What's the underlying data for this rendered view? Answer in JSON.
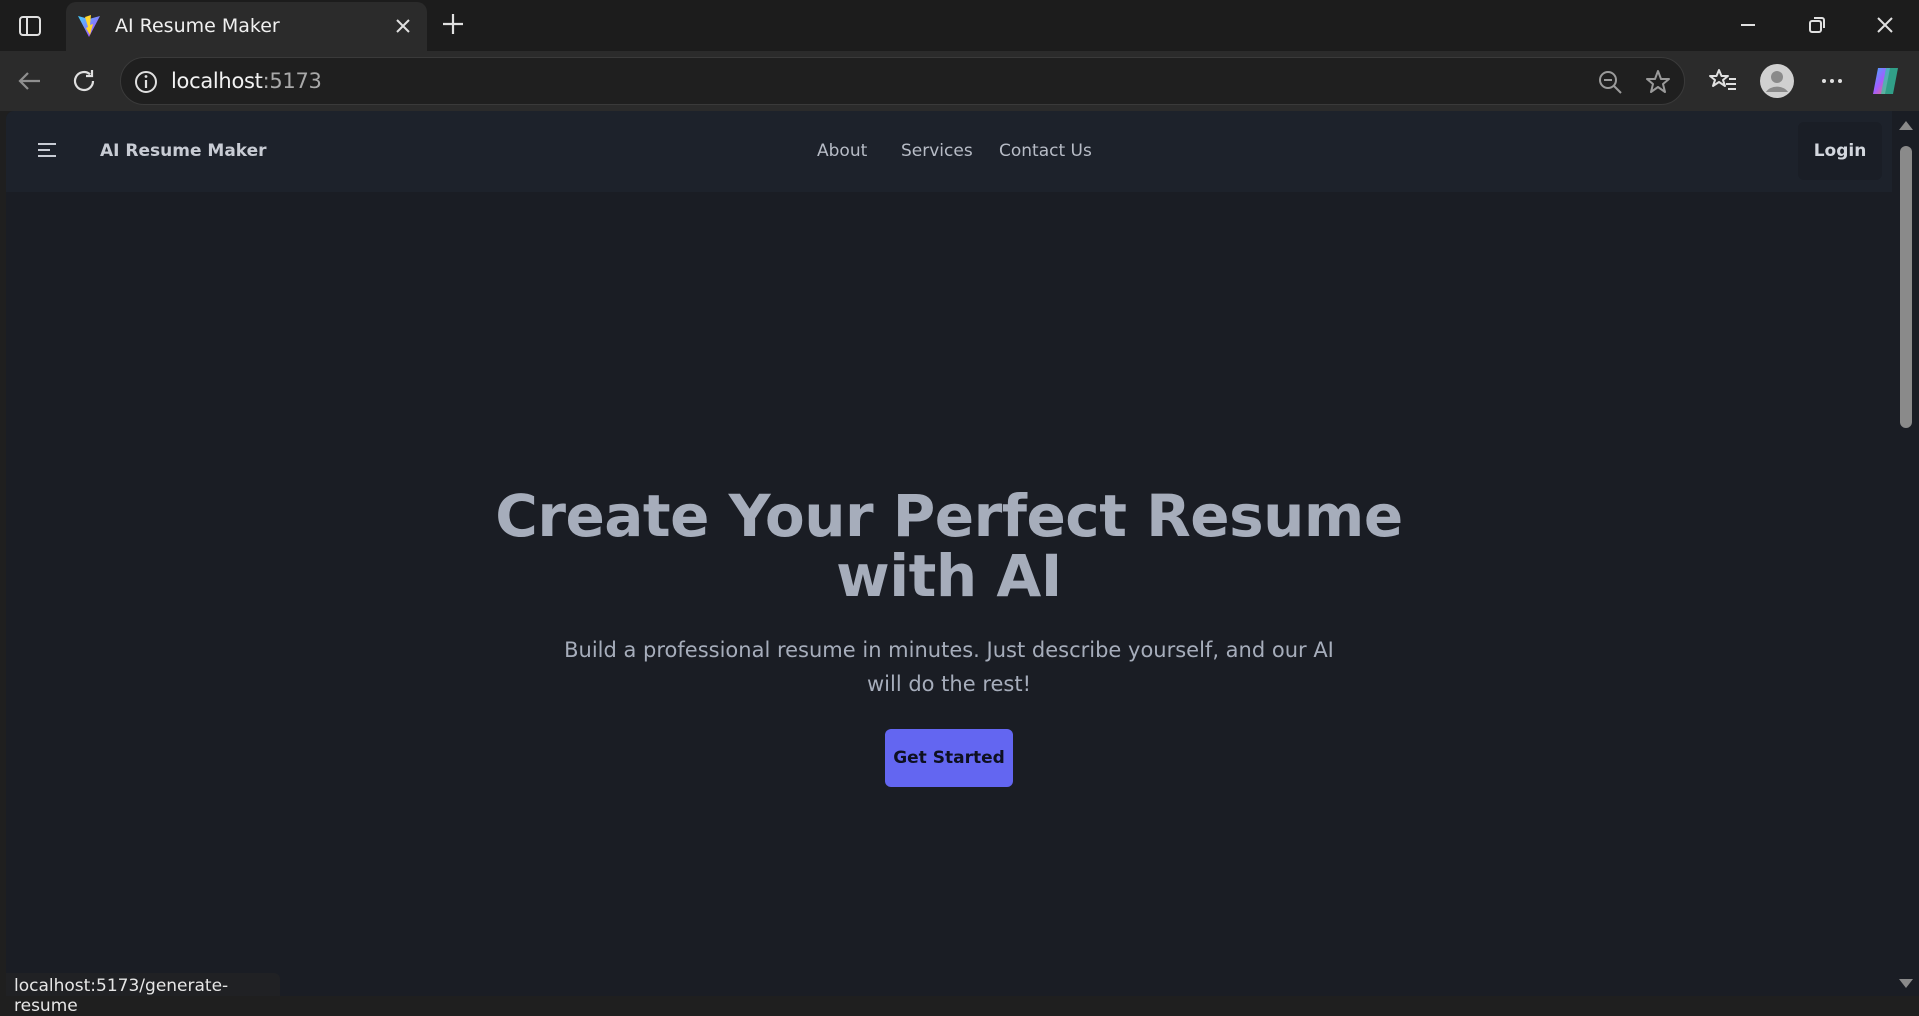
{
  "browser": {
    "tab_title": "AI Resume Maker",
    "url_host": "localhost",
    "url_port": ":5173",
    "status_url": "localhost:5173/generate-resume"
  },
  "nav": {
    "brand": "AI Resume Maker",
    "links": [
      "About",
      "Services",
      "Contact Us"
    ],
    "login": "Login"
  },
  "hero": {
    "title_line1": "Create Your Perfect Resume",
    "title_line2": "with AI",
    "subtitle": "Build a professional resume in minutes. Just describe yourself, and our AI will do the rest!",
    "cta": "Get Started"
  },
  "colors": {
    "page_bg": "#1a1d24",
    "nav_bg": "#1d222b",
    "accent": "#6366f1",
    "heading": "#a6adbb"
  }
}
